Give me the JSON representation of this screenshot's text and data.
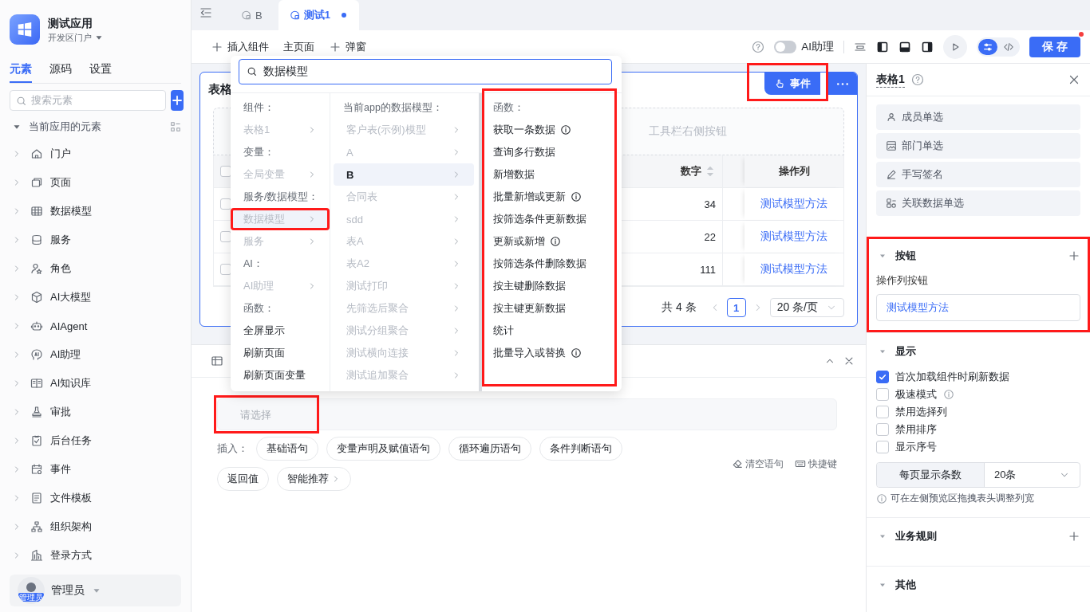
{
  "app": {
    "name": "测试应用",
    "portal": "开发区门户"
  },
  "sidebar": {
    "tabs": [
      {
        "label": "元素",
        "selected": true
      },
      {
        "label": "源码",
        "selected": false
      },
      {
        "label": "设置",
        "selected": false
      }
    ],
    "search": {
      "placeholder": "搜索元素"
    },
    "tree": {
      "label": "当前应用的元素",
      "expanded": true,
      "children": [
        {
          "label": "门户",
          "expanded": false
        },
        {
          "label": "页面",
          "expanded": false
        },
        {
          "label": "数据模型",
          "expanded": false
        },
        {
          "label": "服务",
          "expanded": false
        },
        {
          "label": "角色",
          "expanded": false
        },
        {
          "label": "AI大模型",
          "expanded": false
        },
        {
          "label": "AIAgent",
          "expanded": false
        },
        {
          "label": "AI助理",
          "expanded": false
        },
        {
          "label": "AI知识库",
          "expanded": false
        },
        {
          "label": "审批",
          "expanded": false
        },
        {
          "label": "后台任务",
          "expanded": false
        },
        {
          "label": "事件",
          "expanded": false
        },
        {
          "label": "文件模板",
          "expanded": false
        },
        {
          "label": "组织架构",
          "expanded": false
        },
        {
          "label": "登录方式",
          "expanded": false
        }
      ]
    },
    "user": {
      "name": "管理员",
      "avatar_label": "管理员"
    }
  },
  "editor_tabs": [
    {
      "label": "B",
      "selected": false,
      "modified": false
    },
    {
      "label": "测试1",
      "selected": true,
      "modified": true
    }
  ],
  "toolbar": {
    "actions": [
      {
        "label": "插入组件",
        "kind": "add"
      },
      {
        "label": "主页面",
        "kind": "plain"
      },
      {
        "label": "弹窗",
        "kind": "add"
      }
    ],
    "ai_assistant": {
      "label": "AI助理",
      "on": false
    },
    "view_modes": [
      {
        "selected": true
      },
      {
        "selected": false
      }
    ],
    "save": {
      "label": "保 存",
      "unsaved": true
    }
  },
  "dropdown": {
    "search_value": "数据模型",
    "columns": [
      {
        "annotated": false,
        "entries": [
          {
            "kind": "header",
            "label": "组件："
          },
          {
            "kind": "submenu",
            "label": "表格1",
            "disabled": true,
            "selected": false,
            "annotated": false
          },
          {
            "kind": "header",
            "label": "变量："
          },
          {
            "kind": "submenu",
            "label": "全局变量",
            "disabled": true,
            "selected": false,
            "annotated": false
          },
          {
            "kind": "header",
            "label": "服务/数据模型："
          },
          {
            "kind": "submenu",
            "label": "数据模型",
            "disabled": true,
            "selected": true,
            "annotated": true
          },
          {
            "kind": "submenu",
            "label": "服务",
            "disabled": true,
            "selected": false,
            "annotated": false
          },
          {
            "kind": "header",
            "label": "AI："
          },
          {
            "kind": "submenu",
            "label": "AI助理",
            "disabled": true,
            "selected": false,
            "annotated": false
          },
          {
            "kind": "header",
            "label": "函数："
          },
          {
            "kind": "action",
            "label": "全屏显示",
            "info": false
          },
          {
            "kind": "action",
            "label": "刷新页面",
            "info": false
          },
          {
            "kind": "action",
            "label": "刷新页面变量",
            "info": false
          }
        ]
      },
      {
        "annotated": false,
        "entries": [
          {
            "kind": "header",
            "label": "当前app的数据模型："
          },
          {
            "kind": "submenu",
            "label": "客户表(示例)模型",
            "disabled": true,
            "selected": false,
            "annotated": false
          },
          {
            "kind": "submenu",
            "label": "A",
            "disabled": true,
            "selected": false,
            "annotated": false
          },
          {
            "kind": "submenu",
            "label": "B",
            "disabled": false,
            "selected": true,
            "annotated": false
          },
          {
            "kind": "submenu",
            "label": "合同表",
            "disabled": true,
            "selected": false,
            "annotated": false
          },
          {
            "kind": "submenu",
            "label": "sdd",
            "disabled": true,
            "selected": false,
            "annotated": false
          },
          {
            "kind": "submenu",
            "label": "表A",
            "disabled": true,
            "selected": false,
            "annotated": false
          },
          {
            "kind": "submenu",
            "label": "表A2",
            "disabled": true,
            "selected": false,
            "annotated": false
          },
          {
            "kind": "submenu",
            "label": "测试打印",
            "disabled": true,
            "selected": false,
            "annotated": false
          },
          {
            "kind": "submenu",
            "label": "先筛选后聚合",
            "disabled": true,
            "selected": false,
            "annotated": false
          },
          {
            "kind": "submenu",
            "label": "测试分组聚合",
            "disabled": true,
            "selected": false,
            "annotated": false
          },
          {
            "kind": "submenu",
            "label": "测试横向连接",
            "disabled": true,
            "selected": false,
            "annotated": false
          },
          {
            "kind": "submenu",
            "label": "测试追加聚合",
            "disabled": true,
            "selected": false,
            "annotated": false
          }
        ]
      },
      {
        "annotated": true,
        "entries": [
          {
            "kind": "header",
            "label": "函数："
          },
          {
            "kind": "action",
            "label": "获取一条数据",
            "info": true
          },
          {
            "kind": "action",
            "label": "查询多行数据",
            "info": false
          },
          {
            "kind": "action",
            "label": "新增数据",
            "info": false
          },
          {
            "kind": "action",
            "label": "批量新增或更新",
            "info": true
          },
          {
            "kind": "action",
            "label": "按筛选条件更新数据",
            "info": false
          },
          {
            "kind": "action",
            "label": "更新或新增",
            "info": true
          },
          {
            "kind": "action",
            "label": "按筛选条件删除数据",
            "info": false
          },
          {
            "kind": "action",
            "label": "按主键删除数据",
            "info": false
          },
          {
            "kind": "action",
            "label": "按主键更新数据",
            "info": false
          },
          {
            "kind": "action",
            "label": "统计",
            "info": false
          },
          {
            "kind": "action",
            "label": "批量导入或替换",
            "info": true
          }
        ]
      }
    ]
  },
  "table_card": {
    "title": "表格",
    "event_button": {
      "label": "事件",
      "annotated": true
    },
    "toolbar_placeholder": "工具栏右侧按钮",
    "header_checked": false,
    "columns": [
      {
        "label": "数字",
        "sortable": true
      },
      {
        "label": "操作列",
        "sortable": false
      }
    ],
    "rows": [
      {
        "checked": false,
        "number": "34",
        "action": "测试模型方法"
      },
      {
        "checked": false,
        "number": "22",
        "action": "测试模型方法"
      },
      {
        "checked": false,
        "number": "111",
        "action": "测试模型方法"
      }
    ],
    "pagination": {
      "total": "共 4 条",
      "pages": [
        {
          "label": "1",
          "selected": true
        }
      ],
      "page_size": "20 条/页"
    }
  },
  "expression_panel": {
    "field": {
      "placeholder": "请选择",
      "annotated": true
    },
    "insert_label": "插入：",
    "chips": [
      {
        "label": "基础语句",
        "kind": "plain"
      },
      {
        "label": "变量声明及赋值语句",
        "kind": "plain"
      },
      {
        "label": "循环遍历语句",
        "kind": "plain"
      },
      {
        "label": "条件判断语句",
        "kind": "plain"
      },
      {
        "label": "返回值",
        "kind": "plain"
      },
      {
        "label": "智能推荐",
        "kind": "more"
      }
    ],
    "tools": [
      {
        "label": "清空语句",
        "kind": "clear"
      },
      {
        "label": "快捷键",
        "kind": "keyboard"
      }
    ]
  },
  "properties": {
    "title": "表格1",
    "field_types": [
      "成员单选",
      "部门单选",
      "手写签名",
      "关联数据单选"
    ],
    "sections": [
      {
        "kind": "buttons",
        "title": "按钮",
        "expanded": true,
        "addable": true,
        "annotated": true,
        "label": "操作列按钮",
        "items": [
          "测试模型方法"
        ]
      },
      {
        "kind": "display",
        "title": "显示",
        "expanded": true,
        "addable": false,
        "annotated": false,
        "options": [
          {
            "label": "首次加载组件时刷新数据",
            "checked": true,
            "info": false
          },
          {
            "label": "极速模式",
            "checked": false,
            "info": true
          },
          {
            "label": "禁用选择列",
            "checked": false,
            "info": false
          },
          {
            "label": "禁用排序",
            "checked": false,
            "info": false
          },
          {
            "label": "显示序号",
            "checked": false,
            "info": false
          }
        ],
        "page_size": {
          "label": "每页显示条数",
          "value": "20条"
        },
        "hint": "可在左侧预览区拖拽表头调整列宽"
      },
      {
        "kind": "plain",
        "title": "业务规则",
        "expanded": true,
        "addable": true,
        "annotated": false
      },
      {
        "kind": "plain",
        "title": "其他",
        "expanded": true,
        "addable": false,
        "annotated": false
      }
    ]
  }
}
